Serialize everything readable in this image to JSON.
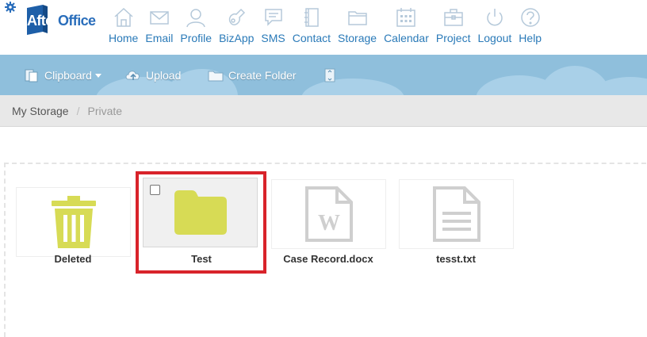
{
  "brand": {
    "name_part1": "After",
    "name_part2": "Office"
  },
  "nav": [
    {
      "label": "Home",
      "icon": "home-icon"
    },
    {
      "label": "Email",
      "icon": "email-icon"
    },
    {
      "label": "Profile",
      "icon": "profile-icon"
    },
    {
      "label": "BizApp",
      "icon": "bizapp-icon"
    },
    {
      "label": "SMS",
      "icon": "sms-icon"
    },
    {
      "label": "Contact",
      "icon": "contact-icon"
    },
    {
      "label": "Storage",
      "icon": "storage-icon"
    },
    {
      "label": "Calendar",
      "icon": "calendar-icon"
    },
    {
      "label": "Project",
      "icon": "project-icon"
    },
    {
      "label": "Logout",
      "icon": "logout-icon"
    },
    {
      "label": "Help",
      "icon": "help-icon"
    }
  ],
  "toolbar": {
    "clipboard": "Clipboard",
    "upload": "Upload",
    "create_folder": "Create Folder"
  },
  "breadcrumb": {
    "root": "My Storage",
    "separator": "/",
    "current": "Private"
  },
  "files": [
    {
      "name": "Deleted",
      "icon": "trash-icon"
    },
    {
      "name": "Test",
      "icon": "folder-icon",
      "selected": true
    },
    {
      "name": "Case Record.docx",
      "icon": "word-document-icon"
    },
    {
      "name": "tesst.txt",
      "icon": "text-file-icon"
    }
  ],
  "colors": {
    "nav_blue": "#2a7ab8",
    "toolbar_blue": "#8fbfdc",
    "folder_yellow": "#d7db55",
    "file_gray": "#cfcfcf",
    "highlight_red": "#d8232a"
  }
}
